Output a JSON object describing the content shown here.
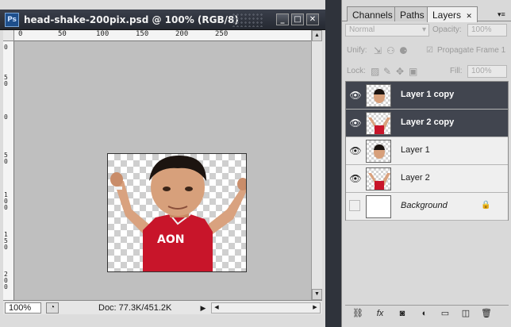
{
  "document": {
    "title": "head-shake-200pix.psd @ 100% (RGB/8)",
    "app_icon_text": "Ps",
    "window_buttons": {
      "minimize": "_",
      "maximize": "□",
      "close": "✕"
    },
    "ruler_top_labels": [
      "0",
      "50",
      "100",
      "150",
      "200",
      "250"
    ],
    "ruler_left_labels": [
      "0",
      "50",
      "0",
      "50",
      "100",
      "150",
      "200"
    ],
    "zoom": "100%",
    "doc_info": "Doc: 77.3K/451.2K"
  },
  "panel": {
    "tabs": [
      {
        "label": "Channels",
        "active": false
      },
      {
        "label": "Paths",
        "active": false
      },
      {
        "label": "Layers",
        "active": true
      }
    ],
    "tab_close": "✕",
    "blend_mode": "Normal",
    "opacity_label": "Opacity:",
    "opacity_value": "100%",
    "unify_label": "Unify:",
    "propagate_label": "Propagate Frame 1",
    "lock_label": "Lock:",
    "fill_label": "Fill:",
    "fill_value": "100%",
    "layers": [
      {
        "name": "Layer 1 copy",
        "selected": true,
        "visible": true,
        "thumb": "head"
      },
      {
        "name": "Layer 2 copy",
        "selected": true,
        "visible": true,
        "thumb": "body"
      },
      {
        "name": "Layer 1",
        "selected": false,
        "visible": true,
        "thumb": "head"
      },
      {
        "name": "Layer 2",
        "selected": false,
        "visible": true,
        "thumb": "body"
      },
      {
        "name": "Background",
        "selected": false,
        "visible": false,
        "thumb": "plain",
        "locked": true
      }
    ],
    "bottom_icons": [
      "link-layers-icon",
      "fx-icon",
      "add-mask-icon",
      "adjustment-layer-icon",
      "new-group-icon",
      "new-layer-icon",
      "delete-layer-icon"
    ],
    "fx_text": "fx"
  },
  "image": {
    "jersey_text": "AON"
  },
  "colors": {
    "selection": "#41454f",
    "titlebar": "#2a2e37",
    "jersey": "#c8152a"
  }
}
